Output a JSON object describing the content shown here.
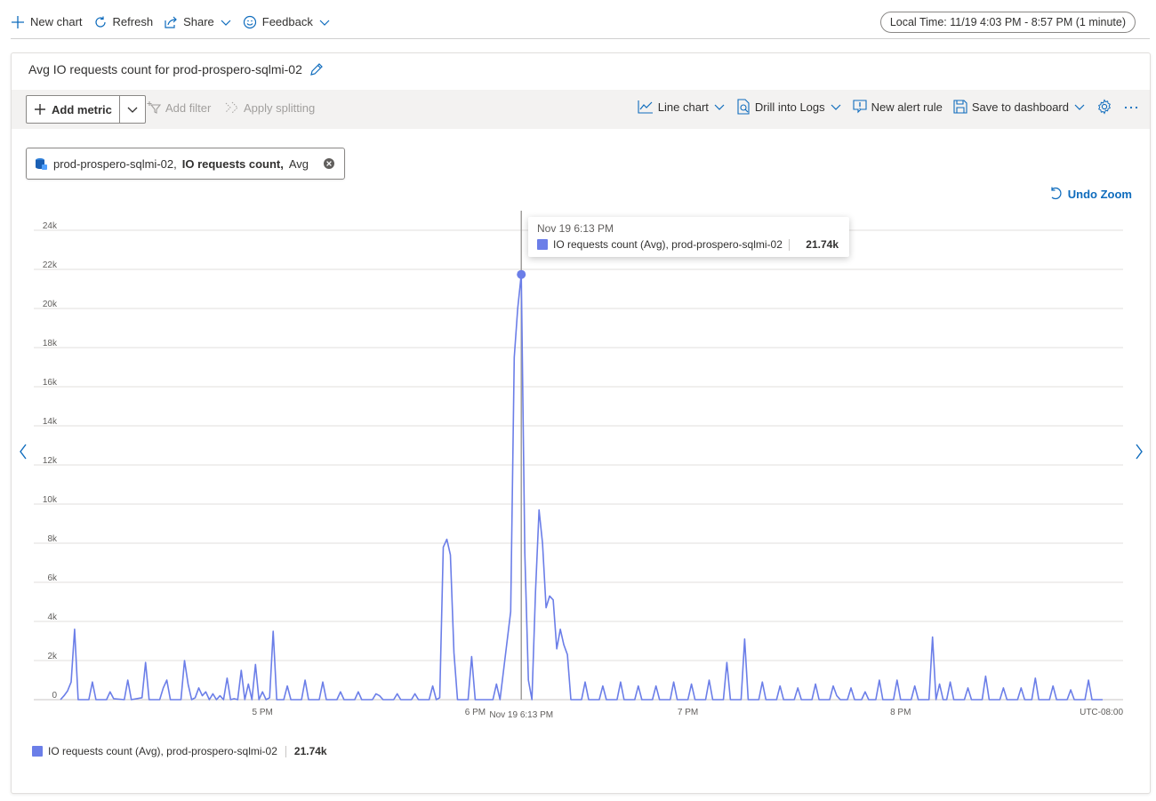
{
  "command_bar": {
    "new_chart": "New chart",
    "refresh": "Refresh",
    "share": "Share",
    "feedback": "Feedback",
    "time_range": "Local Time: 11/19 4:03 PM - 8:57 PM (1 minute)"
  },
  "card": {
    "title": "Avg IO requests count for prod-prospero-sqlmi-02"
  },
  "toolbar": {
    "add_metric": "Add metric",
    "add_filter": "Add filter",
    "apply_splitting": "Apply splitting",
    "line_chart": "Line chart",
    "drill_into_logs": "Drill into Logs",
    "new_alert_rule": "New alert rule",
    "save_to_dashboard": "Save to dashboard"
  },
  "metric_pill": {
    "resource": "prod-prospero-sqlmi-02,",
    "metric": "IO requests count,",
    "aggregation": "Avg"
  },
  "undo_zoom": "Undo Zoom",
  "tooltip": {
    "time": "Nov 19 6:13 PM",
    "series": "IO requests count (Avg), prod-prospero-sqlmi-02",
    "value": "21.74k"
  },
  "legend": {
    "series": "IO requests count (Avg), prod-prospero-sqlmi-02",
    "value": "21.74k"
  },
  "colors": {
    "series": "#6b7ee8",
    "accent": "#0f6cbd"
  },
  "chart_data": {
    "type": "line",
    "title": "",
    "xlabel": "",
    "ylabel": "",
    "timezone_label": "UTC-08:00",
    "y_ticks": [
      "0",
      "2k",
      "4k",
      "6k",
      "8k",
      "10k",
      "12k",
      "14k",
      "16k",
      "18k",
      "20k",
      "22k",
      "24k"
    ],
    "ylim": [
      0,
      24000
    ],
    "x_ticks": [
      {
        "label": "5 PM",
        "minutes": 57
      },
      {
        "label": "6 PM",
        "minutes": 117
      },
      {
        "label": "7 PM",
        "minutes": 177
      },
      {
        "label": "8 PM",
        "minutes": 237
      }
    ],
    "hover_label": {
      "label": "Nov 19 6:13 PM",
      "minutes": 130
    },
    "x_range_minutes": [
      0,
      294
    ],
    "x_start": "11/19 4:03 PM",
    "grid": true,
    "series": [
      {
        "name": "IO requests count (Avg), prod-prospero-sqlmi-02",
        "points": [
          [
            0,
            0
          ],
          [
            1,
            200
          ],
          [
            2,
            450
          ],
          [
            3,
            900
          ],
          [
            4,
            3600
          ],
          [
            5,
            0
          ],
          [
            8,
            0
          ],
          [
            9,
            900
          ],
          [
            10,
            0
          ],
          [
            13,
            0
          ],
          [
            14,
            400
          ],
          [
            15,
            50
          ],
          [
            18,
            0
          ],
          [
            19,
            1000
          ],
          [
            20,
            0
          ],
          [
            23,
            100
          ],
          [
            24,
            1900
          ],
          [
            25,
            0
          ],
          [
            28,
            0
          ],
          [
            29,
            600
          ],
          [
            30,
            1000
          ],
          [
            31,
            0
          ],
          [
            34,
            0
          ],
          [
            35,
            2000
          ],
          [
            36,
            800
          ],
          [
            37,
            0
          ],
          [
            38,
            100
          ],
          [
            39,
            600
          ],
          [
            40,
            200
          ],
          [
            41,
            400
          ],
          [
            42,
            0
          ],
          [
            43,
            300
          ],
          [
            44,
            0
          ],
          [
            45,
            200
          ],
          [
            46,
            0
          ],
          [
            47,
            1100
          ],
          [
            48,
            0
          ],
          [
            49,
            50
          ],
          [
            50,
            0
          ],
          [
            51,
            1500
          ],
          [
            52,
            0
          ],
          [
            53,
            800
          ],
          [
            54,
            0
          ],
          [
            55,
            1800
          ],
          [
            56,
            0
          ],
          [
            57,
            400
          ],
          [
            58,
            0
          ],
          [
            59,
            100
          ],
          [
            60,
            3500
          ],
          [
            61,
            0
          ],
          [
            63,
            0
          ],
          [
            64,
            700
          ],
          [
            65,
            0
          ],
          [
            68,
            0
          ],
          [
            69,
            1000
          ],
          [
            70,
            0
          ],
          [
            73,
            0
          ],
          [
            74,
            900
          ],
          [
            75,
            0
          ],
          [
            78,
            0
          ],
          [
            79,
            400
          ],
          [
            80,
            0
          ],
          [
            83,
            0
          ],
          [
            84,
            400
          ],
          [
            85,
            0
          ],
          [
            88,
            0
          ],
          [
            89,
            300
          ],
          [
            90,
            200
          ],
          [
            91,
            0
          ],
          [
            94,
            0
          ],
          [
            95,
            300
          ],
          [
            96,
            0
          ],
          [
            99,
            0
          ],
          [
            100,
            300
          ],
          [
            101,
            0
          ],
          [
            104,
            0
          ],
          [
            105,
            700
          ],
          [
            106,
            0
          ],
          [
            107,
            100
          ],
          [
            108,
            7800
          ],
          [
            109,
            8200
          ],
          [
            110,
            7400
          ],
          [
            111,
            2400
          ],
          [
            112,
            0
          ],
          [
            115,
            0
          ],
          [
            116,
            2200
          ],
          [
            117,
            0
          ],
          [
            118,
            0
          ],
          [
            119,
            0
          ],
          [
            120,
            0
          ],
          [
            121,
            0
          ],
          [
            122,
            0
          ],
          [
            123,
            800
          ],
          [
            124,
            0
          ],
          [
            127,
            4500
          ],
          [
            128,
            17500
          ],
          [
            129,
            20000
          ],
          [
            130,
            21740
          ],
          [
            131,
            7500
          ],
          [
            132,
            1000
          ],
          [
            133,
            0
          ],
          [
            134,
            5500
          ],
          [
            135,
            9700
          ],
          [
            136,
            8000
          ],
          [
            137,
            4700
          ],
          [
            138,
            5300
          ],
          [
            139,
            5100
          ],
          [
            140,
            2600
          ],
          [
            141,
            3600
          ],
          [
            142,
            2800
          ],
          [
            143,
            2300
          ],
          [
            144,
            0
          ],
          [
            147,
            0
          ],
          [
            148,
            900
          ],
          [
            149,
            0
          ],
          [
            152,
            0
          ],
          [
            153,
            700
          ],
          [
            154,
            0
          ],
          [
            157,
            0
          ],
          [
            158,
            900
          ],
          [
            159,
            0
          ],
          [
            162,
            0
          ],
          [
            163,
            700
          ],
          [
            164,
            0
          ],
          [
            167,
            0
          ],
          [
            168,
            700
          ],
          [
            169,
            0
          ],
          [
            172,
            0
          ],
          [
            173,
            900
          ],
          [
            174,
            0
          ],
          [
            177,
            0
          ],
          [
            178,
            800
          ],
          [
            179,
            0
          ],
          [
            182,
            0
          ],
          [
            183,
            1000
          ],
          [
            184,
            0
          ],
          [
            187,
            0
          ],
          [
            188,
            1900
          ],
          [
            189,
            0
          ],
          [
            192,
            0
          ],
          [
            193,
            3100
          ],
          [
            194,
            0
          ],
          [
            197,
            0
          ],
          [
            198,
            900
          ],
          [
            199,
            0
          ],
          [
            202,
            0
          ],
          [
            203,
            700
          ],
          [
            204,
            0
          ],
          [
            207,
            0
          ],
          [
            208,
            600
          ],
          [
            209,
            0
          ],
          [
            212,
            0
          ],
          [
            213,
            800
          ],
          [
            214,
            0
          ],
          [
            217,
            0
          ],
          [
            218,
            700
          ],
          [
            219,
            200
          ],
          [
            220,
            0
          ],
          [
            222,
            0
          ],
          [
            223,
            600
          ],
          [
            224,
            0
          ],
          [
            226,
            0
          ],
          [
            227,
            400
          ],
          [
            228,
            0
          ],
          [
            230,
            0
          ],
          [
            231,
            1000
          ],
          [
            232,
            0
          ],
          [
            235,
            0
          ],
          [
            236,
            1000
          ],
          [
            237,
            0
          ],
          [
            240,
            0
          ],
          [
            241,
            700
          ],
          [
            242,
            0
          ],
          [
            245,
            0
          ],
          [
            246,
            3200
          ],
          [
            247,
            0
          ],
          [
            248,
            800
          ],
          [
            249,
            0
          ],
          [
            250,
            0
          ],
          [
            251,
            900
          ],
          [
            252,
            0
          ],
          [
            255,
            0
          ],
          [
            256,
            600
          ],
          [
            257,
            0
          ],
          [
            260,
            0
          ],
          [
            261,
            1200
          ],
          [
            262,
            0
          ],
          [
            265,
            0
          ],
          [
            266,
            600
          ],
          [
            267,
            0
          ],
          [
            270,
            0
          ],
          [
            271,
            600
          ],
          [
            272,
            0
          ],
          [
            274,
            0
          ],
          [
            275,
            1100
          ],
          [
            276,
            0
          ],
          [
            279,
            0
          ],
          [
            280,
            700
          ],
          [
            281,
            0
          ],
          [
            284,
            0
          ],
          [
            285,
            500
          ],
          [
            286,
            0
          ],
          [
            289,
            0
          ],
          [
            290,
            1000
          ],
          [
            291,
            0
          ],
          [
            294,
            0
          ]
        ]
      }
    ],
    "highlighted_point": {
      "minutes": 130,
      "value": 21740
    }
  }
}
